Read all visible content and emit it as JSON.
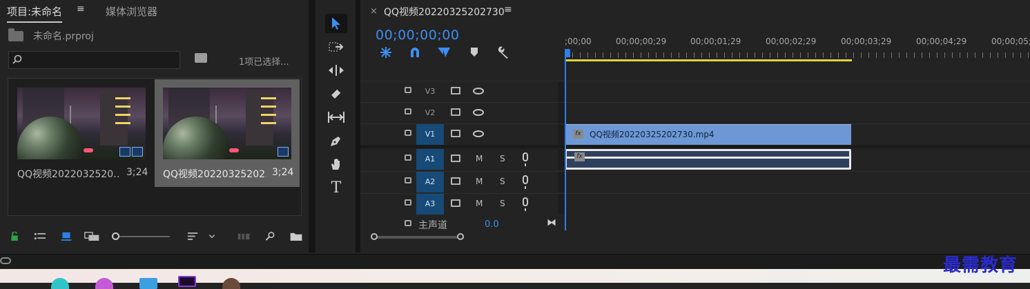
{
  "project_panel": {
    "tab_project": "项目:未命名",
    "tab_menu": "≡",
    "tab_media_browser": "媒体浏览器",
    "project_file": "未命名.prproj",
    "search_placeholder": "",
    "selection_status": "1项已选择...",
    "clips": [
      {
        "name": "QQ视频2022032520…",
        "duration": "3;24",
        "selected": false
      },
      {
        "name": "QQ视频20220325202…",
        "duration": "3;24",
        "selected": true
      }
    ],
    "icon_view_slider": 0
  },
  "tools": [
    "selection-tool",
    "track-select-forward-tool",
    "ripple-edit-tool",
    "razor-tool",
    "slip-tool",
    "pen-tool",
    "hand-tool",
    "type-tool"
  ],
  "timeline": {
    "close_label": "×",
    "sequence_title": "QQ视频20220325202730",
    "sequence_menu": "≡",
    "timecode": "00;00;00;00",
    "ruler_labels": [
      ";00;00",
      "00;00;00;29",
      "00;00;01;29",
      "00;00;02;29",
      "00;00;03;29",
      "00;00;04;29",
      "00;00;05;"
    ],
    "video_tracks": [
      "V3",
      "V2",
      "V1"
    ],
    "audio_tracks": [
      "A1",
      "A2",
      "A3"
    ],
    "mute_label": "M",
    "solo_label": "S",
    "master_label": "主声道",
    "master_value": "0.0",
    "v1_clip_name": "QQ视频20220325202730.mp4",
    "fx_label": "fx"
  },
  "watermark": "最需教育",
  "colors": {
    "accent": "#3d8ef2",
    "track_active": "#174a77",
    "video_clip": "#6d98d5",
    "work_area": "#e2d43a"
  }
}
